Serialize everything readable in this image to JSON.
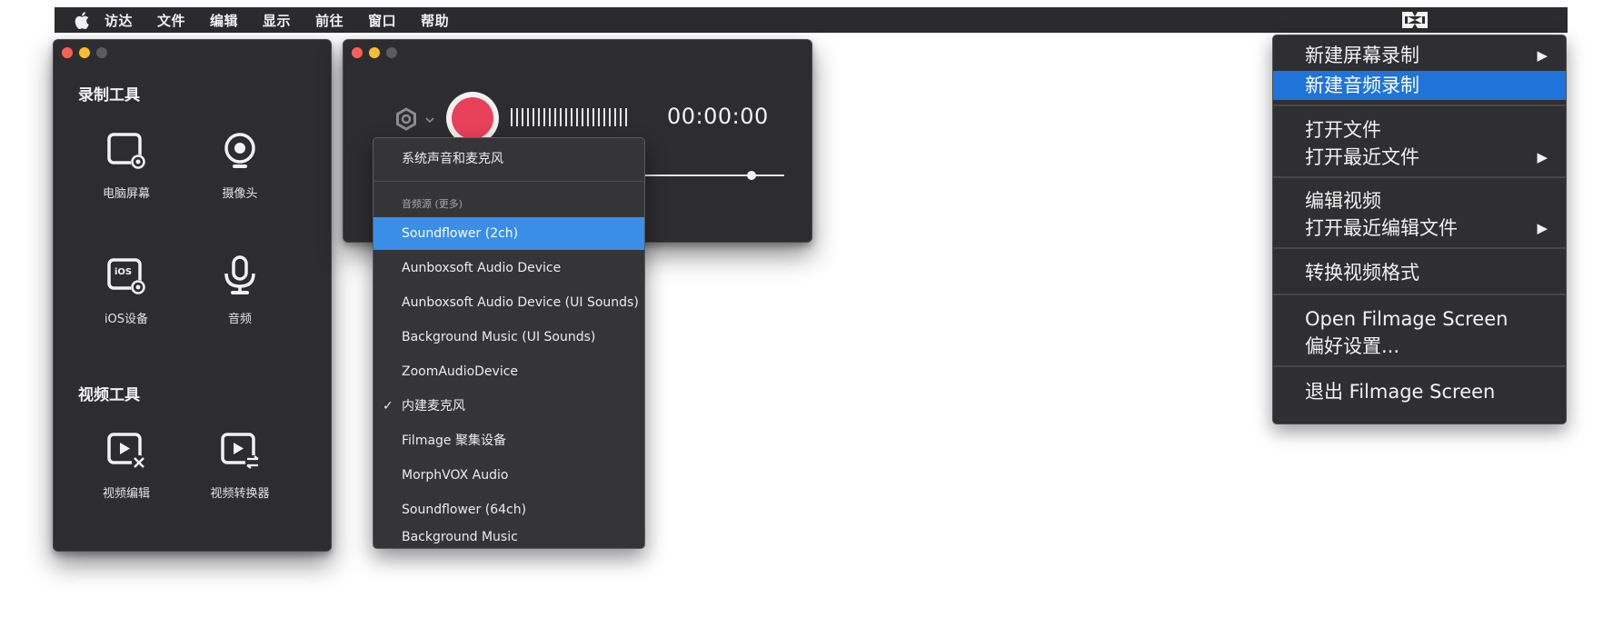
{
  "menubar": {
    "apple_icon": "apple-logo-icon",
    "items": [
      "访达",
      "文件",
      "编辑",
      "显示",
      "前往",
      "窗口",
      "帮助"
    ],
    "tray_icon": "filmage-tray-icon"
  },
  "tools_window": {
    "record_section": "录制工具",
    "record_tools": [
      {
        "label": "电脑屏幕",
        "icon": "screen-record-icon"
      },
      {
        "label": "摄像头",
        "icon": "webcam-icon"
      },
      {
        "label": "iOS设备",
        "icon": "ios-device-icon"
      },
      {
        "label": "音频",
        "icon": "microphone-icon"
      }
    ],
    "video_section": "视频工具",
    "video_tools": [
      {
        "label": "视频编辑",
        "icon": "video-edit-icon"
      },
      {
        "label": "视频转换器",
        "icon": "video-convert-icon"
      }
    ],
    "ios_badge": "iOS"
  },
  "recorder": {
    "timer": "00:00:00",
    "record_color": "#e8415a",
    "volume": 0.82
  },
  "audio_popup": {
    "top_item": "系统声音和麦克风",
    "section_header": "音频源 (更多)",
    "sources": [
      "Soundflower (2ch)",
      "Aunboxsoft Audio Device",
      "Aunboxsoft Audio Device (UI Sounds)",
      "Background Music (UI Sounds)",
      "ZoomAudioDevice",
      "内建麦克风",
      "Filmage 聚集设备",
      "MorphVOX Audio",
      "Soundflower (64ch)",
      "Background Music"
    ],
    "highlighted": "Soundflower (2ch)",
    "checked": "内建麦克风",
    "check_mark": "✓",
    "highlight_color": "#3a8ee8"
  },
  "tray_menu": {
    "items": [
      {
        "label": "新建屏幕录制",
        "submenu": true
      },
      {
        "label": "新建音频录制",
        "submenu": false
      },
      {
        "label": "打开文件",
        "submenu": false
      },
      {
        "label": "打开最近文件",
        "submenu": true
      },
      {
        "label": "编辑视频",
        "submenu": false
      },
      {
        "label": "打开最近编辑文件",
        "submenu": true
      },
      {
        "label": "转换视频格式",
        "submenu": false
      },
      {
        "label": "Open Filmage Screen",
        "submenu": false
      },
      {
        "label": "偏好设置...",
        "submenu": false
      },
      {
        "label": "退出 Filmage Screen",
        "submenu": false
      }
    ],
    "highlighted": "新建音频录制",
    "submenu_arrow": "▶",
    "highlight_color": "#1f74d9"
  }
}
